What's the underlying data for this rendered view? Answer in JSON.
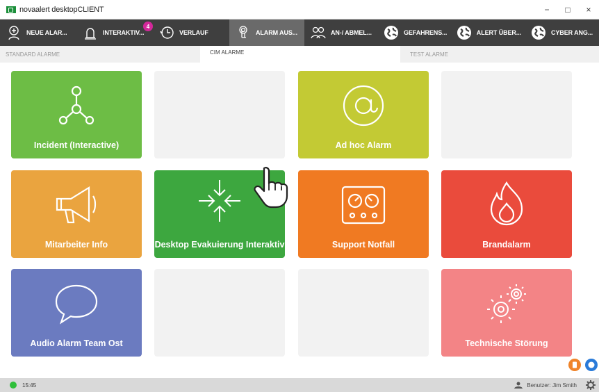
{
  "window": {
    "title": "novaalert desktopCLIENT",
    "controls": {
      "minimize": "−",
      "maximize": "□",
      "close": "×"
    }
  },
  "toolbar": {
    "items": [
      {
        "label": "NEUE ALAR...",
        "icon": "new-alarm-icon"
      },
      {
        "label": "INTERAKTIV...",
        "icon": "bell-icon",
        "badge": "4"
      },
      {
        "label": "VERLAUF",
        "icon": "history-clock-icon"
      },
      {
        "label": "ALARM AUS...",
        "icon": "touch-alarm-icon",
        "active": true
      },
      {
        "label": "AN-/ ABMEL...",
        "icon": "users-icon"
      },
      {
        "label": "GEFAHRENS...",
        "icon": "globe-icon"
      },
      {
        "label": "ALERT ÜBER...",
        "icon": "globe-icon"
      },
      {
        "label": "CYBER ANG...",
        "icon": "globe-icon"
      }
    ]
  },
  "tabs": [
    {
      "label": "STANDARD ALARME",
      "active": false
    },
    {
      "label": "CIM ALARME",
      "active": true
    },
    {
      "label": "TEST ALARME",
      "active": false
    }
  ],
  "tiles": [
    {
      "label": "Incident (Interactive)",
      "color": "#6dbd45",
      "icon": "network-nodes-icon"
    },
    {
      "label": "",
      "color": "#f2f2f2",
      "icon": ""
    },
    {
      "label": "Ad hoc Alarm",
      "color": "#c3ca34",
      "icon": "at-sign-icon"
    },
    {
      "label": "",
      "color": "#f2f2f2",
      "icon": ""
    },
    {
      "label": "Mitarbeiter Info",
      "color": "#eaa43f",
      "icon": "megaphone-icon"
    },
    {
      "label": "Desktop Evakuierung Interaktiv",
      "color": "#3da73f",
      "icon": "converging-arrows-icon"
    },
    {
      "label": "Support Notfall",
      "color": "#f07a22",
      "icon": "control-panel-icon"
    },
    {
      "label": "Brandalarm",
      "color": "#ea4b3c",
      "icon": "fire-icon"
    },
    {
      "label": "Audio Alarm Team Ost",
      "color": "#6b7bc0",
      "icon": "speech-bubble-icon"
    },
    {
      "label": "",
      "color": "#f2f2f2",
      "icon": ""
    },
    {
      "label": "",
      "color": "#f2f2f2",
      "icon": ""
    },
    {
      "label": "Technische Störung",
      "color": "#f38486",
      "icon": "gears-icon"
    }
  ],
  "side_buttons": [
    {
      "icon": "clipboard-icon",
      "color": "#f0842a"
    },
    {
      "icon": "chat-icon",
      "color": "#2a7bd9"
    }
  ],
  "status": {
    "time": "15:45",
    "user": "Benutzer: Jim Smith",
    "online_color": "#2fbf3a"
  }
}
